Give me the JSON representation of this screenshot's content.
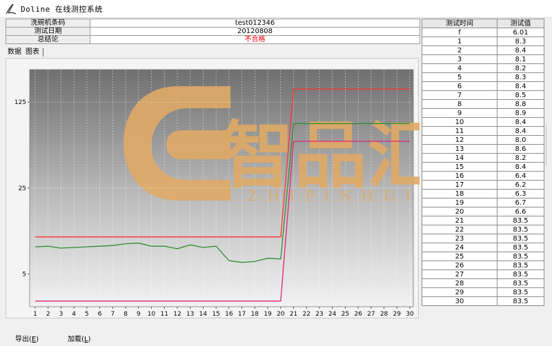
{
  "window": {
    "title": "Doline 在线测控系统"
  },
  "info": {
    "rows": [
      {
        "label": "洗碗机条码",
        "value": "test012346"
      },
      {
        "label": "测试日期",
        "value": "20120808"
      },
      {
        "label": "总结论",
        "value": "不合格"
      }
    ]
  },
  "tabs": [
    {
      "label": "数据"
    },
    {
      "label": "图表"
    }
  ],
  "watermark": {
    "text": "智品汇",
    "sub": "Z H I P I N H U I",
    "color": "#e0aa66"
  },
  "chart_data": {
    "type": "line",
    "title": "",
    "xlabel": "",
    "ylabel": "",
    "x": [
      1,
      2,
      3,
      4,
      5,
      6,
      7,
      8,
      9,
      10,
      11,
      12,
      13,
      14,
      15,
      16,
      17,
      18,
      19,
      20,
      21,
      22,
      23,
      24,
      25,
      26,
      27,
      28,
      29,
      30
    ],
    "x_tick_labels": [
      "1",
      "2",
      "3",
      "4",
      "5",
      "6",
      "7",
      "8",
      "9",
      "10",
      "11",
      "12",
      "13",
      "14",
      "15",
      "16",
      "17",
      "18",
      "19",
      "20",
      "21",
      "22",
      "23",
      "24",
      "25",
      "26",
      "27",
      "28",
      "29",
      "30"
    ],
    "y_scale": "log",
    "y_ticks": [
      5,
      25,
      125
    ],
    "y_tick_labels": [
      "5",
      "25",
      "125"
    ],
    "ylim": [
      2.7,
      230
    ],
    "grid": "vertical dotted",
    "series": [
      {
        "color": "#2e8b2e",
        "values": [
          8.3,
          8.4,
          8.1,
          8.2,
          8.3,
          8.4,
          8.5,
          8.8,
          8.9,
          8.4,
          8.4,
          8.0,
          8.6,
          8.2,
          8.4,
          6.4,
          6.2,
          6.3,
          6.7,
          6.6,
          83.5,
          83.5,
          83.5,
          83.5,
          83.5,
          83.5,
          83.5,
          83.5,
          83.5,
          83.5
        ]
      },
      {
        "color": "#ff3030",
        "values": [
          10,
          10,
          10,
          10,
          10,
          10,
          10,
          10,
          10,
          10,
          10,
          10,
          10,
          10,
          10,
          10,
          10,
          10,
          10,
          10,
          160,
          160,
          160,
          160,
          160,
          160,
          160,
          160,
          160,
          160
        ]
      },
      {
        "color": "#e0207a",
        "values": [
          3,
          3,
          3,
          3,
          3,
          3,
          3,
          3,
          3,
          3,
          3,
          3,
          3,
          3,
          3,
          3,
          3,
          3,
          3,
          3,
          60,
          60,
          60,
          60,
          60,
          60,
          60,
          60,
          60,
          60
        ]
      }
    ]
  },
  "results": {
    "headers": [
      "测试时间",
      "测试值"
    ],
    "rows": [
      [
        "f",
        "6.01"
      ],
      [
        "1",
        "8.3"
      ],
      [
        "2",
        "8.4"
      ],
      [
        "3",
        "8.1"
      ],
      [
        "4",
        "8.2"
      ],
      [
        "5",
        "8.3"
      ],
      [
        "6",
        "8.4"
      ],
      [
        "7",
        "8.5"
      ],
      [
        "8",
        "8.8"
      ],
      [
        "9",
        "8.9"
      ],
      [
        "10",
        "8.4"
      ],
      [
        "11",
        "8.4"
      ],
      [
        "12",
        "8.0"
      ],
      [
        "13",
        "8.6"
      ],
      [
        "14",
        "8.2"
      ],
      [
        "15",
        "8.4"
      ],
      [
        "16",
        "6.4"
      ],
      [
        "17",
        "6.2"
      ],
      [
        "18",
        "6.3"
      ],
      [
        "19",
        "6.7"
      ],
      [
        "20",
        "6.6"
      ],
      [
        "21",
        "83.5"
      ],
      [
        "22",
        "83.5"
      ],
      [
        "23",
        "83.5"
      ],
      [
        "24",
        "83.5"
      ],
      [
        "25",
        "83.5"
      ],
      [
        "26",
        "83.5"
      ],
      [
        "27",
        "83.5"
      ],
      [
        "28",
        "83.5"
      ],
      [
        "29",
        "83.5"
      ],
      [
        "30",
        "83.5"
      ]
    ]
  },
  "footer": {
    "export": {
      "label": "导出(",
      "key": "E",
      "end": ")"
    },
    "load": {
      "label": "加载(",
      "key": "L",
      "end": ")"
    }
  }
}
